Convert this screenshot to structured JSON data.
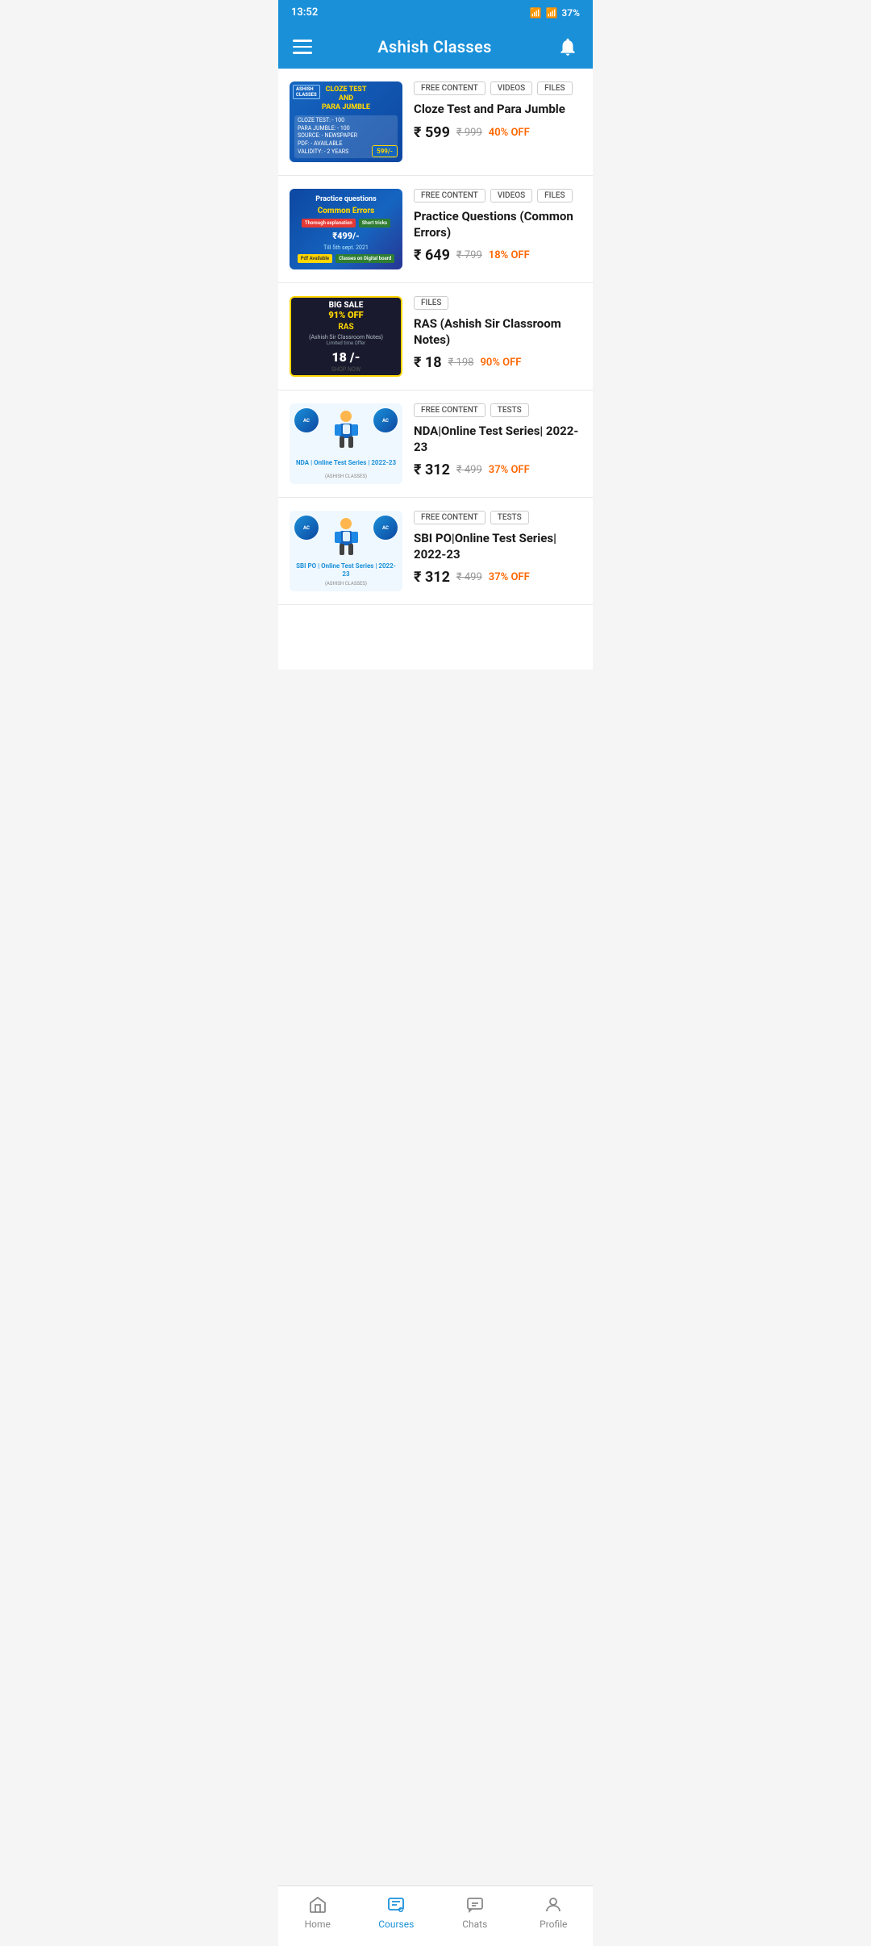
{
  "statusBar": {
    "time": "13:52",
    "battery": "37%"
  },
  "header": {
    "title": "Ashish Classes"
  },
  "courses": [
    {
      "id": 1,
      "tags": [
        "FREE CONTENT",
        "VIDEOS",
        "FILES"
      ],
      "title": "Cloze Test and Para Jumble",
      "currentPrice": "₹ 599",
      "originalPrice": "₹ 999",
      "discount": "40% OFF",
      "thumbType": "cloze"
    },
    {
      "id": 2,
      "tags": [
        "FREE CONTENT",
        "VIDEOS",
        "FILES"
      ],
      "title": "Practice Questions (Common Errors)",
      "currentPrice": "₹ 649",
      "originalPrice": "₹ 799",
      "discount": "18% OFF",
      "thumbType": "practice"
    },
    {
      "id": 3,
      "tags": [
        "FILES"
      ],
      "title": "RAS (Ashish Sir Classroom Notes)",
      "currentPrice": "₹ 18",
      "originalPrice": "₹ 198",
      "discount": "90% OFF",
      "thumbType": "ras"
    },
    {
      "id": 4,
      "tags": [
        "FREE CONTENT",
        "TESTS"
      ],
      "title": "NDA|Online Test Series| 2022-23",
      "currentPrice": "₹ 312",
      "originalPrice": "₹ 499",
      "discount": "37% OFF",
      "thumbType": "nda",
      "thumbLabel": "NDA | Online Test Series | 2022-23"
    },
    {
      "id": 5,
      "tags": [
        "FREE CONTENT",
        "TESTS"
      ],
      "title": "SBI PO|Online Test Series| 2022-23",
      "currentPrice": "₹ 312",
      "originalPrice": "₹ 499",
      "discount": "37% OFF",
      "thumbType": "sbi",
      "thumbLabel": "SBI PO | Online Test Series | 2022-23"
    }
  ],
  "bottomNav": {
    "items": [
      {
        "id": "home",
        "label": "Home",
        "active": false
      },
      {
        "id": "courses",
        "label": "Courses",
        "active": true
      },
      {
        "id": "chats",
        "label": "Chats",
        "active": false
      },
      {
        "id": "profile",
        "label": "Profile",
        "active": false
      }
    ]
  }
}
